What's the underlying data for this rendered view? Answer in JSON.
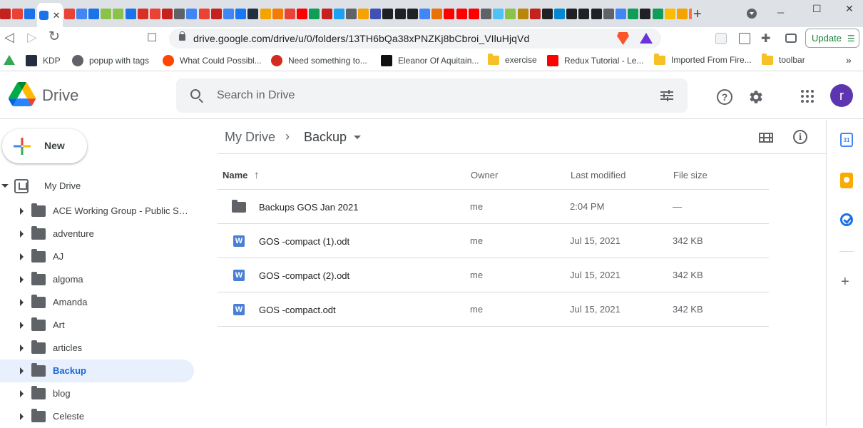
{
  "browser": {
    "url": "drive.google.com/drive/u/0/folders/13TH6bQa38xPNZKj8bCbroi_VIluHjqVd",
    "new_tab_symbol": "+",
    "close_tab_symbol": "✕",
    "update_label": "Update",
    "bookmarks": [
      {
        "label": "KDP",
        "icon": "amazon-icon",
        "color": "#232f3e"
      },
      {
        "label": "popup with tags",
        "icon": "globe-icon",
        "color": "#5f6368"
      },
      {
        "label": "What Could Possibl...",
        "icon": "reddit-icon",
        "color": "#ff4500"
      },
      {
        "label": "Need something to...",
        "icon": "cbc-icon",
        "color": "#d52b1e"
      },
      {
        "label": "Eleanor Of Aquitain...",
        "icon": "history-icon",
        "color": "#111111"
      },
      {
        "label": "exercise",
        "icon": "folder-icon",
        "color": "#f6c026"
      },
      {
        "label": "Redux Tutorial - Le...",
        "icon": "youtube-icon",
        "color": "#ff0000"
      },
      {
        "label": "Imported From Fire...",
        "icon": "folder-icon",
        "color": "#f6c026"
      },
      {
        "label": "toolbar",
        "icon": "folder-icon",
        "color": "#f6c026"
      }
    ],
    "more_bookmarks_symbol": "»"
  },
  "drive": {
    "app_name": "Drive",
    "search_placeholder": "Search in Drive",
    "avatar_letter": "r",
    "help_symbol": "?",
    "new_button_label": "New",
    "nav": {
      "my_drive_label": "My Drive",
      "folders": [
        {
          "label": "ACE Working Group - Public Ser...",
          "selected": false
        },
        {
          "label": "adventure",
          "selected": false
        },
        {
          "label": "AJ",
          "selected": false
        },
        {
          "label": "algoma",
          "selected": false
        },
        {
          "label": "Amanda",
          "selected": false
        },
        {
          "label": "Art",
          "selected": false
        },
        {
          "label": "articles",
          "selected": false
        },
        {
          "label": "Backup",
          "selected": true
        },
        {
          "label": "blog",
          "selected": false
        },
        {
          "label": "Celeste",
          "selected": false
        }
      ]
    },
    "breadcrumb": {
      "root": "My Drive",
      "separator": "›",
      "current": "Backup"
    },
    "info_symbol": "i",
    "table": {
      "headers": {
        "name": "Name",
        "owner": "Owner",
        "modified": "Last modified",
        "size": "File size"
      },
      "sort_symbol": "↑",
      "rows": [
        {
          "type": "folder",
          "name": "Backups GOS Jan 2021",
          "owner": "me",
          "modified": "2:04 PM",
          "size": "—"
        },
        {
          "type": "word",
          "name": "GOS -compact (1).odt",
          "owner": "me",
          "modified": "Jul 15, 2021",
          "size": "342 KB"
        },
        {
          "type": "word",
          "name": "GOS -compact (2).odt",
          "owner": "me",
          "modified": "Jul 15, 2021",
          "size": "342 KB"
        },
        {
          "type": "word",
          "name": "GOS -compact.odt",
          "owner": "me",
          "modified": "Jul 15, 2021",
          "size": "342 KB"
        }
      ],
      "word_icon_letter": "W"
    },
    "side_panel": {
      "calendar_day": "31",
      "add_symbol": "+"
    }
  },
  "colors": {
    "accent": "#1a73e8",
    "selected_bg": "#e8f0fe",
    "avatar": "#5e35b1"
  }
}
